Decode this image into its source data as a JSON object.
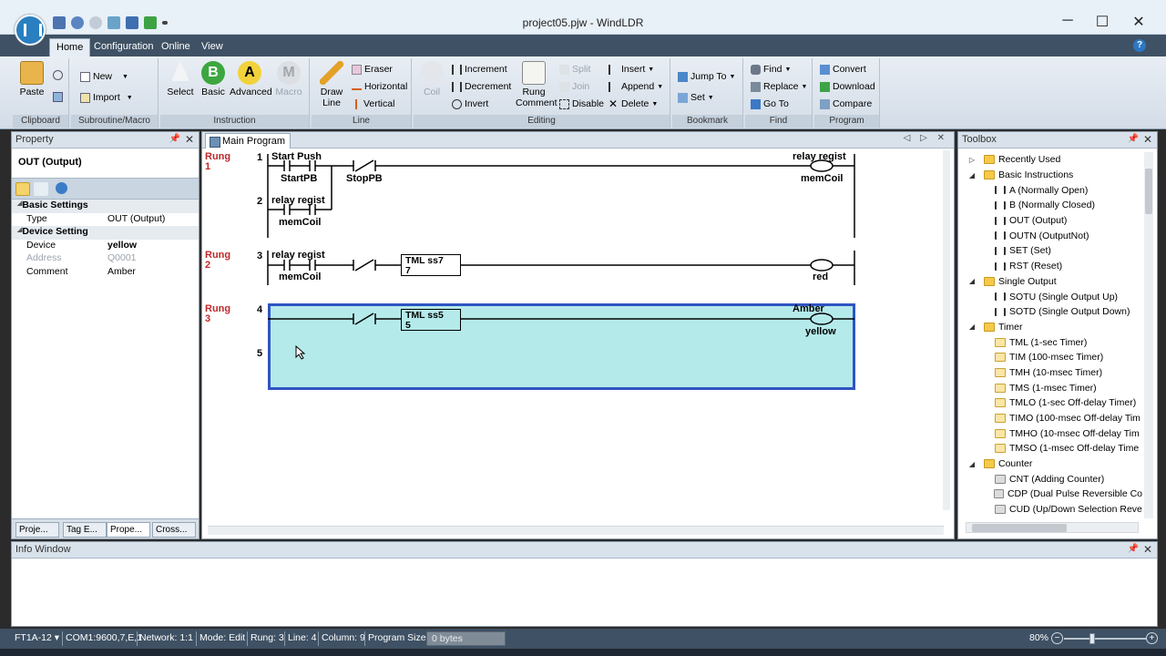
{
  "window": {
    "title": "project05.pjw - WindLDR",
    "minimize": "─",
    "maximize": "☐",
    "close": "✕"
  },
  "ribbon_tabs": [
    "Home",
    "Configuration",
    "Online",
    "View"
  ],
  "ribbon": {
    "clipboard": {
      "label": "Clipboard",
      "paste": "Paste"
    },
    "subroutine": {
      "label": "Subroutine/Macro",
      "new": "New",
      "import": "Import"
    },
    "instruction": {
      "label": "Instruction",
      "select": "Select",
      "basic": "Basic",
      "advanced": "Advanced",
      "macro": "Macro"
    },
    "line": {
      "label": "Line",
      "draw_line": "Draw Line",
      "eraser": "Eraser",
      "horizontal": "Horizontal",
      "vertical": "Vertical"
    },
    "editing": {
      "label": "Editing",
      "coil": "Coil",
      "increment": "Increment",
      "decrement": "Decrement",
      "invert": "Invert",
      "rung_comment": "Rung Comment",
      "split": "Split",
      "join": "Join",
      "disable": "Disable",
      "insert": "Insert",
      "append": "Append",
      "delete": "Delete"
    },
    "bookmark": {
      "label": "Bookmark",
      "jump_to": "Jump To",
      "set": "Set"
    },
    "find": {
      "label": "Find",
      "find": "Find",
      "replace": "Replace",
      "go_to": "Go To"
    },
    "program": {
      "label": "Program",
      "convert": "Convert",
      "download": "Download",
      "compare": "Compare"
    }
  },
  "property_panel": {
    "title": "Property",
    "heading": "OUT (Output)",
    "categories": [
      {
        "name": "Basic Settings",
        "rows": [
          {
            "key": "Type",
            "value": "OUT (Output)"
          }
        ]
      },
      {
        "name": "Device Setting",
        "rows": [
          {
            "key": "Device",
            "value": "yellow"
          },
          {
            "key": "Address",
            "value": "Q0001"
          },
          {
            "key": "Comment",
            "value": "Amber"
          }
        ]
      }
    ],
    "tabs": [
      "Proje...",
      "Tag E...",
      "Prope...",
      "Cross..."
    ]
  },
  "main": {
    "tab_label": "Main Program",
    "rung_word": "Rung",
    "rungs": [
      "1",
      "2",
      "3"
    ],
    "lines": [
      "1",
      "2",
      "3",
      "4",
      "5"
    ],
    "labels": {
      "start_push": "Start Push",
      "startpb": "StartPB",
      "stoppb": "StopPB",
      "relay_regist_1": "relay regist",
      "memcoil_1": "memCoil",
      "relay_regist_2": "relay regist",
      "memcoil_2": "memCoil",
      "relay_regist_3": "relay regist",
      "memcoil_3": "memCoil",
      "timer1_name": "TML ss7",
      "timer1_val": "7",
      "red": "red",
      "timer2_name": "TML ss5",
      "timer2_val": "5",
      "amber": "Amber",
      "yellow": "yellow"
    }
  },
  "toolbox": {
    "title": "Toolbox",
    "items": [
      {
        "level": 0,
        "exp": "▷",
        "icon": "folder-icon",
        "label": "Recently Used"
      },
      {
        "level": 0,
        "exp": "◢",
        "icon": "folder-icon",
        "label": "Basic Instructions"
      },
      {
        "level": 1,
        "exp": "",
        "icon": "contact-no-icon",
        "label": "A (Normally Open)"
      },
      {
        "level": 1,
        "exp": "",
        "icon": "contact-nc-icon",
        "label": "B (Normally Closed)"
      },
      {
        "level": 1,
        "exp": "",
        "icon": "coil-icon",
        "label": "OUT (Output)"
      },
      {
        "level": 1,
        "exp": "",
        "icon": "coil-not-icon",
        "label": "OUTN (OutputNot)"
      },
      {
        "level": 1,
        "exp": "",
        "icon": "set-icon",
        "label": "SET (Set)"
      },
      {
        "level": 1,
        "exp": "",
        "icon": "reset-icon",
        "label": "RST (Reset)"
      },
      {
        "level": 0,
        "exp": "◢",
        "icon": "folder-icon",
        "label": "Single Output"
      },
      {
        "level": 1,
        "exp": "",
        "icon": "pulse-up-icon",
        "label": "SOTU (Single Output Up)"
      },
      {
        "level": 1,
        "exp": "",
        "icon": "pulse-down-icon",
        "label": "SOTD (Single Output Down)"
      },
      {
        "level": 0,
        "exp": "◢",
        "icon": "folder-icon",
        "label": "Timer"
      },
      {
        "level": 1,
        "exp": "",
        "icon": "timer-icon",
        "label": "TML (1-sec Timer)"
      },
      {
        "level": 1,
        "exp": "",
        "icon": "timer-icon",
        "label": "TIM (100-msec Timer)"
      },
      {
        "level": 1,
        "exp": "",
        "icon": "timer-icon",
        "label": "TMH (10-msec Timer)"
      },
      {
        "level": 1,
        "exp": "",
        "icon": "timer-icon",
        "label": "TMS (1-msec Timer)"
      },
      {
        "level": 1,
        "exp": "",
        "icon": "timer-icon",
        "label": "TMLO (1-sec Off-delay Timer)"
      },
      {
        "level": 1,
        "exp": "",
        "icon": "timer-icon",
        "label": "TIMO (100-msec Off-delay Tim"
      },
      {
        "level": 1,
        "exp": "",
        "icon": "timer-icon",
        "label": "TMHO (10-msec Off-delay Tim"
      },
      {
        "level": 1,
        "exp": "",
        "icon": "timer-icon",
        "label": "TMSO (1-msec Off-delay Time"
      },
      {
        "level": 0,
        "exp": "◢",
        "icon": "folder-icon",
        "label": "Counter"
      },
      {
        "level": 1,
        "exp": "",
        "icon": "counter-icon",
        "label": "CNT (Adding Counter)"
      },
      {
        "level": 1,
        "exp": "",
        "icon": "counter-icon",
        "label": "CDP (Dual Pulse Reversible Co"
      },
      {
        "level": 1,
        "exp": "",
        "icon": "counter-icon",
        "label": "CUD (Up/Down Selection Reve"
      }
    ]
  },
  "info_window": {
    "title": "Info Window"
  },
  "status_bar": {
    "plc": "FT1A-12",
    "com": "COM1:9600,7,E,1",
    "network": "Network: 1:1",
    "mode": "Mode: Edit",
    "rung": "Rung: 3",
    "line": "Line: 4",
    "column": "Column: 9",
    "program_size_label": "Program Size:",
    "program_size_value": "0 bytes",
    "zoom": "80%"
  },
  "colors": {
    "accent": "#3f5164",
    "rung_label": "#c0282a",
    "selection": "#b5eaeb",
    "selection_border": "#2f54c2"
  }
}
